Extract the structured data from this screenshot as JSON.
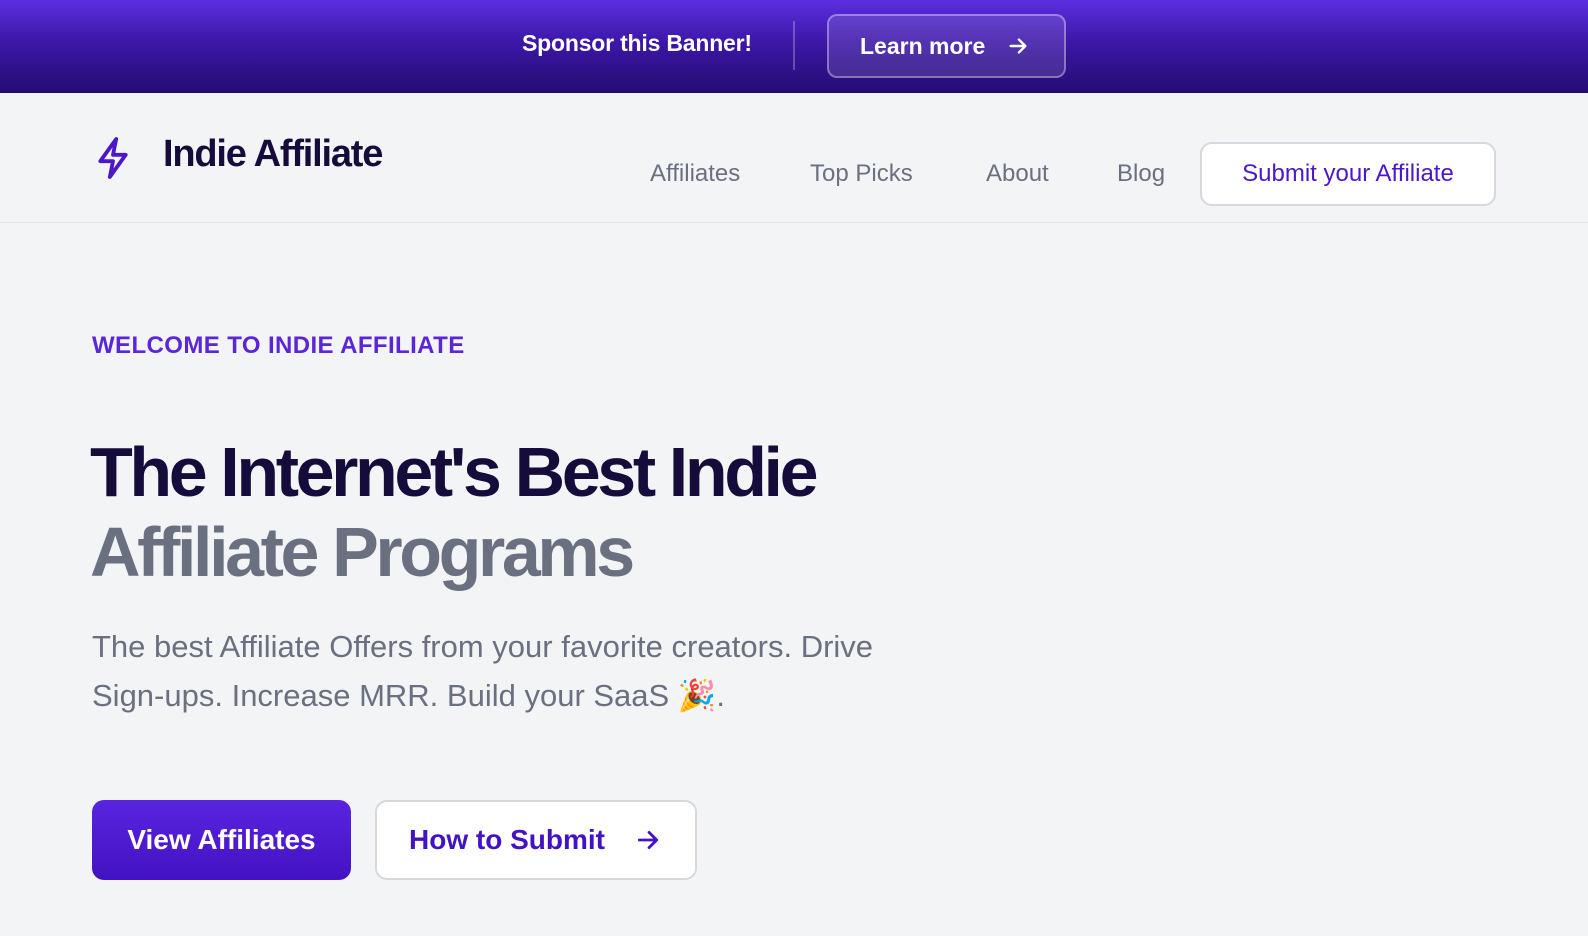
{
  "banner": {
    "text": "Sponsor this Banner!",
    "button_label": "Learn more",
    "button_icon": "arrow-right-icon"
  },
  "header": {
    "brand": "Indie Affiliate",
    "logo_icon": "lightning-bolt-icon",
    "nav": [
      {
        "label": "Affiliates"
      },
      {
        "label": "Top Picks"
      },
      {
        "label": "About"
      },
      {
        "label": "Blog"
      }
    ],
    "submit_label": "Submit your Affiliate"
  },
  "hero": {
    "eyebrow": "WELCOME TO INDIE AFFILIATE",
    "headline_line1": "The Internet's Best Indie",
    "headline_line2": "Affiliate Programs",
    "subtext_line1": "The best Affiliate Offers from your favorite creators. Drive",
    "subtext_line2": "Sign-ups. Increase MRR. Build your SaaS 🎉.",
    "primary_cta": "View Affiliates",
    "secondary_cta": "How to Submit",
    "secondary_icon": "arrow-right-icon"
  },
  "colors": {
    "accent": "#4b17c9",
    "banner_top": "#5b2fe0",
    "banner_bottom": "#240c72",
    "heading": "#160c3b",
    "muted": "#6b7080",
    "background": "#f3f4f6"
  }
}
